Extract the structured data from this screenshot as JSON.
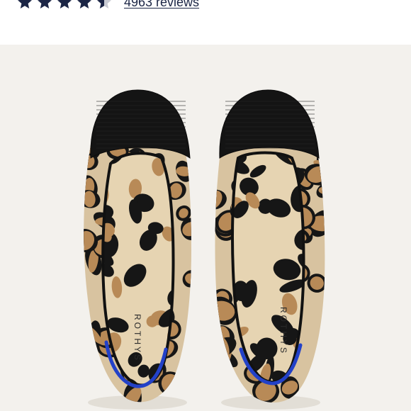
{
  "rating": {
    "value": 4.5,
    "max": 5,
    "star_color": "#1b2545",
    "empty_star_color": "#c9cbd3"
  },
  "reviews": {
    "label": "4963 reviews"
  },
  "product_image": {
    "background": "#f3f1ed",
    "toe_color": "#141414",
    "print_base": "#d8c3a0",
    "spot_color": "#b88a57",
    "rosette_color": "#161616",
    "binding_color": "#2341c8",
    "insole_mark": "ROTHYS"
  }
}
